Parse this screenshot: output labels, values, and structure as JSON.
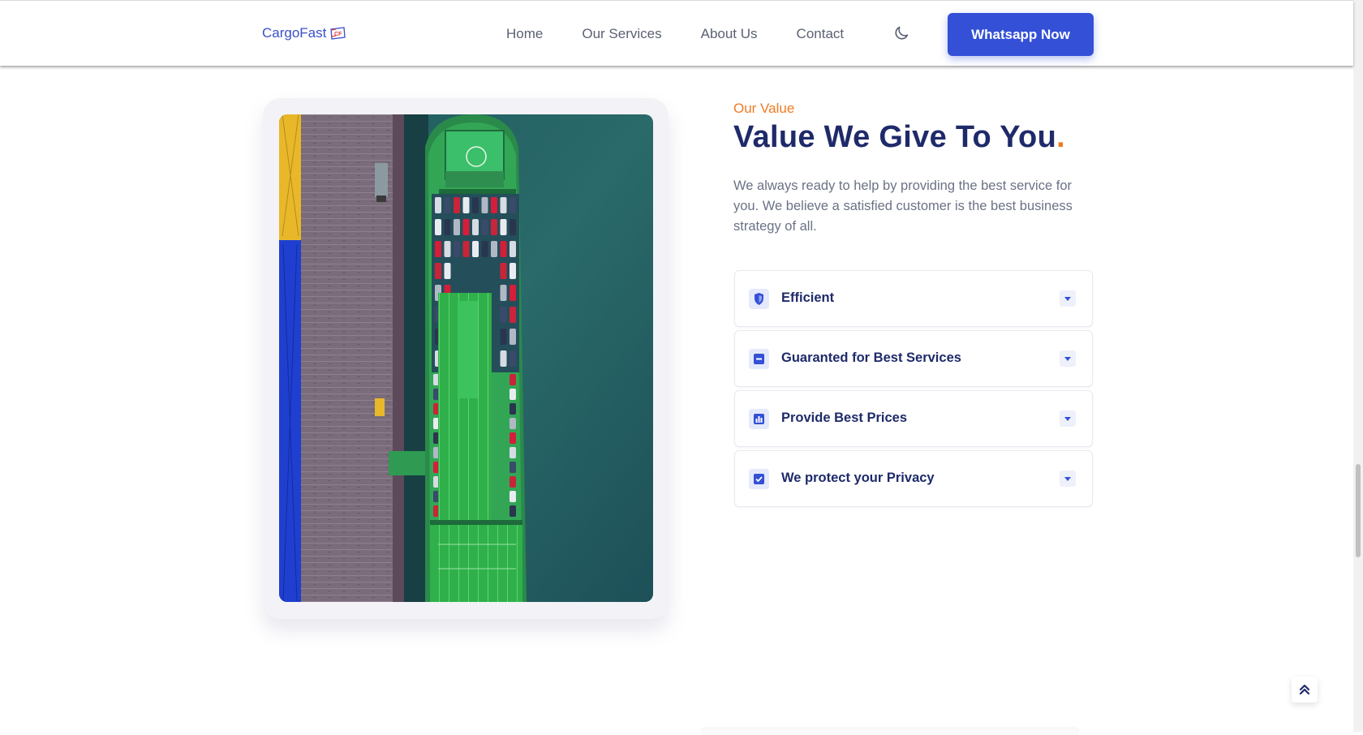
{
  "navbar": {
    "brand": "CargoFast",
    "brand_mark": "CF",
    "links": [
      "Home",
      "Our Services",
      "About Us",
      "Contact"
    ],
    "theme_toggle_icon": "moon-icon",
    "cta_label": "Whatsapp Now"
  },
  "value_section": {
    "eyebrow": "Our Value",
    "heading": "Value We Give To You",
    "heading_dot": ".",
    "description": "We always ready to help by providing the best service for you. We believe a satisfied customer is the best business strategy of all.",
    "accordion": [
      {
        "label": "Efficient",
        "icon": "shield-icon"
      },
      {
        "label": "Guaranted for Best Services",
        "icon": "minus-square-icon"
      },
      {
        "label": "Provide Best Prices",
        "icon": "bar-chart-icon"
      },
      {
        "label": "We protect your Privacy",
        "icon": "checkbox-icon"
      }
    ]
  },
  "colors": {
    "primary": "#3450d6",
    "heading": "#1e2a6a",
    "accent": "#f07b22",
    "text_muted": "#6a7285"
  },
  "scroll_to_top_icon": "double-chevron-up-icon"
}
